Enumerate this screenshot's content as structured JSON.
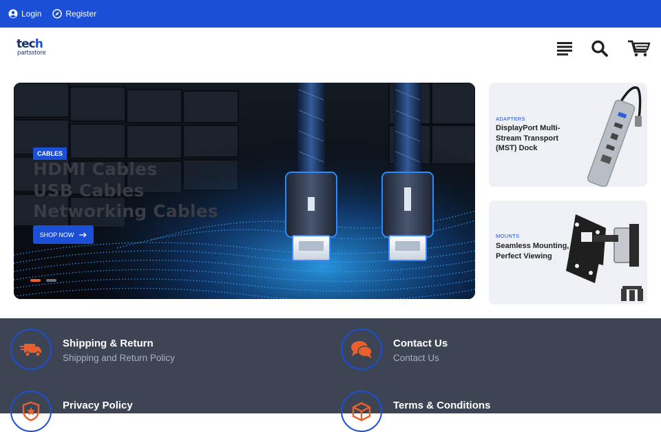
{
  "topbar": {
    "login_label": "Login",
    "register_label": "Register",
    "background": "#1a4fd6"
  },
  "header": {
    "logo_main_1": "tec",
    "logo_main_2": "h",
    "logo_sub": "partsstore",
    "icons": [
      "menu-icon",
      "search-icon",
      "cart-icon"
    ]
  },
  "hero": {
    "badge": "CABLES",
    "lines": [
      "HDMI Cables",
      "USB Cables",
      "Networking Cables"
    ],
    "button_label": "SHOP NOW",
    "slides_total": 2,
    "active_slide": 1
  },
  "promos": [
    {
      "category": "ADAPTERS",
      "title": "DisplayPort Multi-Stream Transport (MST) Dock"
    },
    {
      "category": "MOUNTS",
      "title": "Seamless Mounting, Perfect Viewing"
    }
  ],
  "info": [
    {
      "title": "Shipping & Return",
      "subtitle": "Shipping and Return Policy",
      "icon": "truck-icon"
    },
    {
      "title": "Contact Us",
      "subtitle": "Contact Us",
      "icon": "chat-icon"
    },
    {
      "title": "Privacy Policy",
      "subtitle": "",
      "icon": "shield-icon"
    },
    {
      "title": "Terms & Conditions",
      "subtitle": "",
      "icon": "box-icon"
    }
  ],
  "colors": {
    "accent": "#1a4fd6",
    "icon_orange": "#e8612c",
    "band_bg": "#3d4453"
  }
}
